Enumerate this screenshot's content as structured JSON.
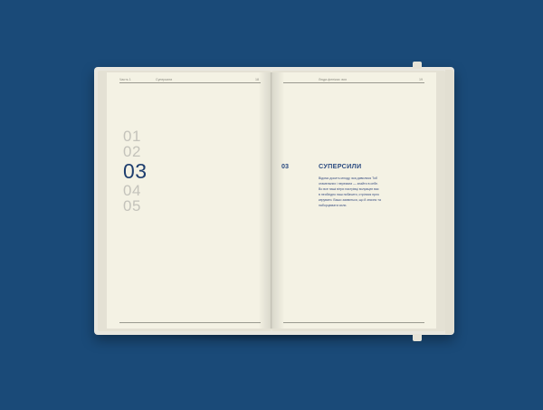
{
  "left_page": {
    "header_left": "Чаcть 1",
    "header_mid": "Суперсили",
    "header_right": "18",
    "numbers": [
      "01",
      "02",
      "03",
      "04",
      "05"
    ],
    "active_index": 2
  },
  "right_page": {
    "header_mid": "Люди-фенікси: вих",
    "header_right": "19",
    "chapter_number": "03",
    "chapter_title": "СУПЕРСИЛИ",
    "body_lines": [
      "Відомо досить млоду, яка дивилися Тоб",
      "отамельних і перемаги — знайти в себе.",
      "Во все наші вітри настрівці волрацеє вас",
      "в необхідно наш побачити, стрілися прло",
      "керувати. Вашо заявиться, що й значно та",
      "наборцювати сили."
    ]
  },
  "colors": {
    "background": "#1a4a78",
    "accent": "#2a4a80",
    "page": "#f4f2e4"
  }
}
